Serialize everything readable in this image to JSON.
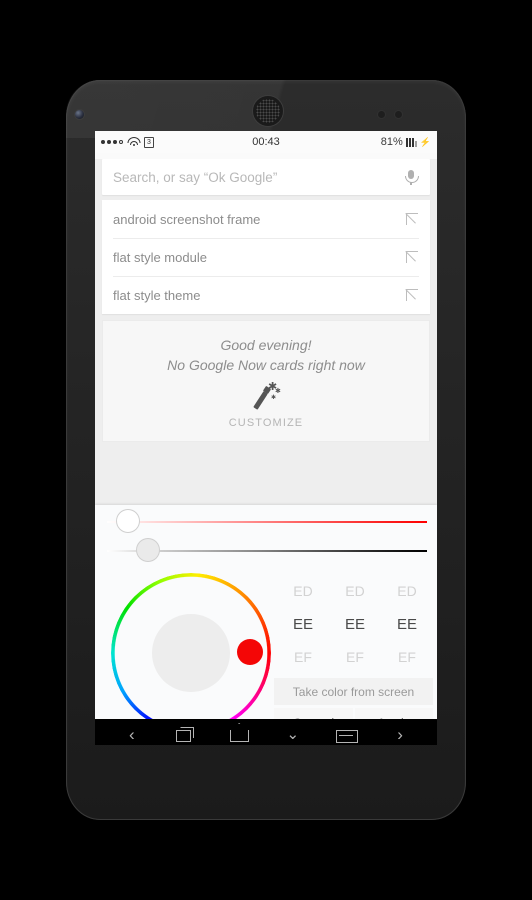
{
  "device": {
    "name": "nexus-phone-frame"
  },
  "status_bar": {
    "signal_dots": [
      "filled",
      "filled",
      "filled",
      "empty"
    ],
    "wifi_icon": "wifi-icon",
    "sim_badge": "3",
    "time": "00:43",
    "battery_percent": "81%",
    "battery_icon": "battery-bars-icon",
    "charging_icon": "⚡"
  },
  "search": {
    "placeholder": "Search, or say “Ok Google”",
    "value": "",
    "mic_icon": "microphone-icon"
  },
  "suggestions": [
    {
      "text": "android screenshot frame",
      "icon": "arrow-northwest-icon"
    },
    {
      "text": "flat style module",
      "icon": "arrow-northwest-icon"
    },
    {
      "text": "flat style theme",
      "icon": "arrow-northwest-icon"
    }
  ],
  "now_card": {
    "greeting": "Good evening!",
    "subtitle": "No Google Now cards right now",
    "icon": "magic-wand-icon",
    "customize_label": "CUSTOMIZE"
  },
  "color_dialog": {
    "sliders": [
      {
        "name": "saturation",
        "from_color": "#ffffff",
        "to_color": "#ff0000",
        "knob_position_percent": 0,
        "knob_color": "#ffffff"
      },
      {
        "name": "value",
        "from_color": "#ffffff",
        "to_color": "#000000",
        "knob_position_percent": 6,
        "knob_color": "#eaeaea"
      }
    ],
    "hue_wheel": {
      "name": "hue-ring",
      "selected_hue_degrees": 0,
      "selector_color": "#f40606",
      "preview_color": "#ededed"
    },
    "hex_columns": [
      {
        "channel": "red",
        "above": "ED",
        "selected": "EE",
        "below": "EF"
      },
      {
        "channel": "green",
        "above": "ED",
        "selected": "EE",
        "below": "EF"
      },
      {
        "channel": "blue",
        "above": "ED",
        "selected": "EE",
        "below": "EF"
      }
    ],
    "selected_hex": "EEEEEE",
    "take_color_label": "Take color from screen",
    "cancel_label": "Cancel",
    "apply_label": "Apply"
  },
  "navbar": {
    "items": [
      {
        "name": "back-chevron-icon",
        "glyph": "‹"
      },
      {
        "name": "recents-icon",
        "glyph": ""
      },
      {
        "name": "home-icon",
        "glyph": ""
      },
      {
        "name": "hide-keyboard-icon",
        "glyph": "⌄"
      },
      {
        "name": "menu-icon",
        "glyph": ""
      },
      {
        "name": "forward-chevron-icon",
        "glyph": "›"
      }
    ]
  }
}
